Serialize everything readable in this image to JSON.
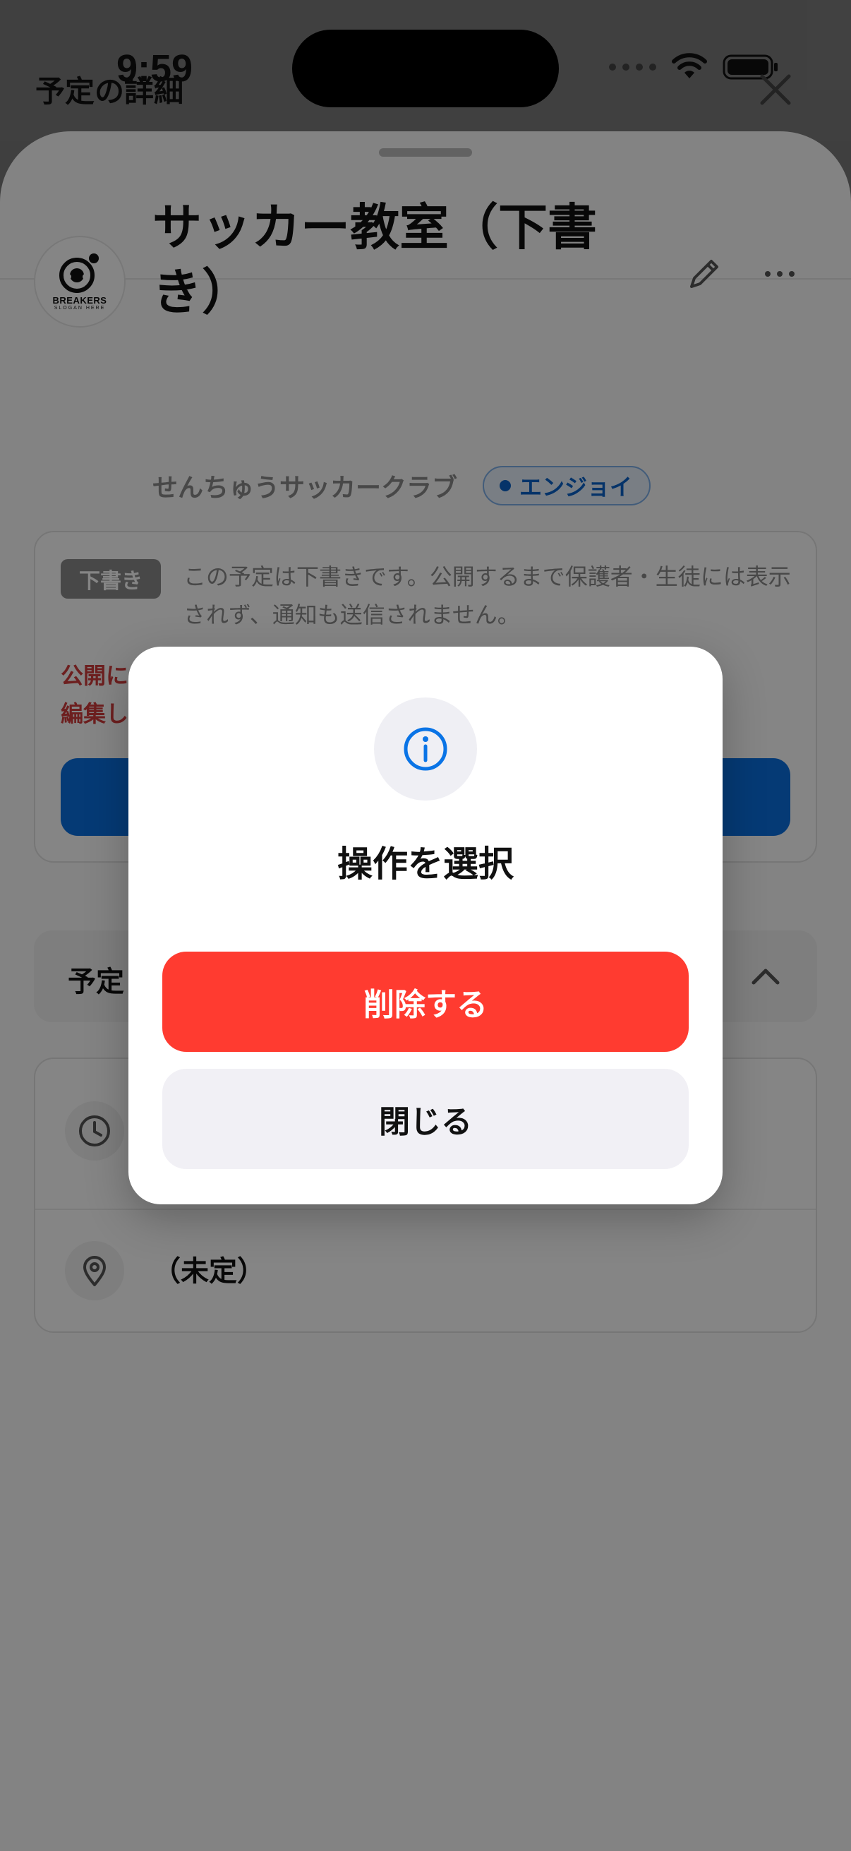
{
  "status_bar": {
    "time": "9:59"
  },
  "sheet": {
    "title": "予定の詳細"
  },
  "event": {
    "title_line1": "サッカー教室（下書",
    "title_line2": "き）",
    "club_name": "せんちゅうサッカークラブ",
    "tag": "エンジョイ",
    "logo": {
      "name": "BREAKERS",
      "slogan": "SLOGAN HERE"
    }
  },
  "draft": {
    "badge": "下書き",
    "message": "この予定は下書きです。公開するまで保護者・生徒には表示されず、通知も送信されません。",
    "warning_line1": "公開に",
    "warning_line2": "編集し"
  },
  "section": {
    "title": "予定"
  },
  "info": {
    "location": "（未定）"
  },
  "dialog": {
    "title": "操作を選択",
    "delete_label": "削除する",
    "close_label": "閉じる"
  },
  "colors": {
    "accent": "#0a6fe0",
    "danger": "#ff3b30",
    "tag": "#0a63c9"
  }
}
